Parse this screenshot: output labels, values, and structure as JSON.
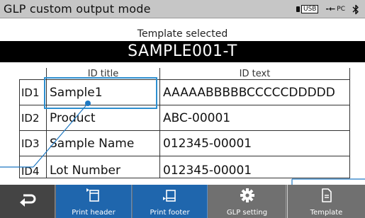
{
  "titlebar": {
    "title": "GLP custom output mode",
    "usb_label": "USB",
    "pc_label": "PC"
  },
  "template": {
    "label": "Template selected",
    "name": "SAMPLE001-T"
  },
  "table": {
    "headers": [
      "ID title",
      "ID text"
    ],
    "rows": [
      {
        "id": "ID1",
        "title": "Sample1",
        "text": "AAAAABBBBBCCCCCDDDDD"
      },
      {
        "id": "ID2",
        "title": "Product",
        "text": "ABC-00001"
      },
      {
        "id": "ID3",
        "title": "Sample Name",
        "text": "012345-00001"
      },
      {
        "id": "ID4",
        "title": "Lot Number",
        "text": "012345-00001"
      }
    ]
  },
  "toolbar": {
    "back_icon": "return-arrow-icon",
    "print_header": "Print header",
    "print_footer": "Print footer",
    "glp_setting": "GLP setting",
    "template": "Template"
  },
  "colors": {
    "titlebar_bg": "#c6c6c6",
    "template_bar_bg": "#000000",
    "toolbar_bg": "#6e6e6e",
    "active_button": "#1f66ad",
    "highlight": "#2d8fd0"
  }
}
